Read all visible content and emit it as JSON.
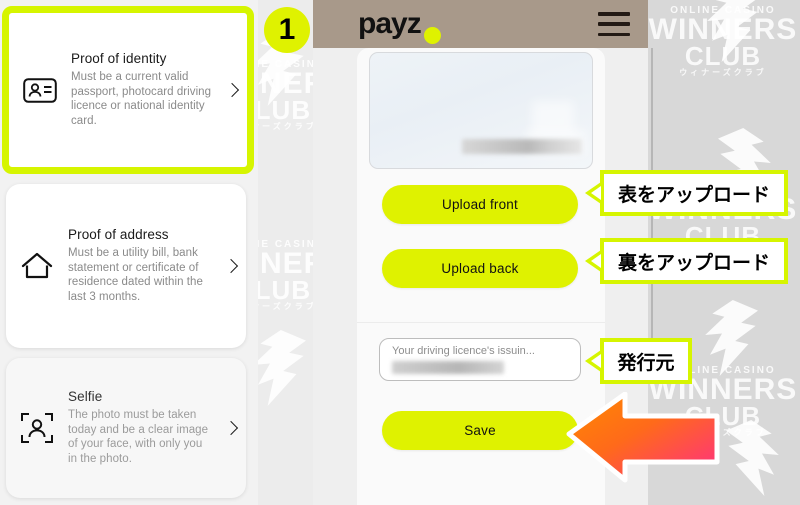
{
  "badge": {
    "number": "1"
  },
  "sidebar": {
    "cards": [
      {
        "id": "proof-of-identity",
        "title": "Proof of identity",
        "description": "Must be a current valid passport, photocard driving licence or national identity card.",
        "icon": "id-card-icon",
        "selected": true
      },
      {
        "id": "proof-of-address",
        "title": "Proof of address",
        "description": "Must be a utility bill, bank statement or certificate of residence dated within the last 3 months.",
        "icon": "home-icon",
        "selected": false
      },
      {
        "id": "selfie",
        "title": "Selfie",
        "description": "The photo must be taken today and be a clear image of your face, with only you in the photo.",
        "icon": "selfie-person-icon",
        "selected": false
      }
    ],
    "chevron_icon": "chevron-right-icon"
  },
  "phone": {
    "header": {
      "logo_text": "payz",
      "logo_dot": "payz-dot-icon",
      "menu_icon": "hamburger-menu-icon",
      "background_color": "#a8998a"
    },
    "preview": {
      "label": "document-preview-image",
      "blurred": true
    },
    "buttons": {
      "upload_front": "Upload front",
      "upload_back": "Upload back",
      "save": "Save"
    },
    "field": {
      "label": "Your driving licence's issuin...",
      "value_blurred": true
    }
  },
  "callouts": [
    {
      "id": "upload-front",
      "text": "表をアップロード"
    },
    {
      "id": "upload-back",
      "text": "裏をアップロード"
    },
    {
      "id": "issuer",
      "text": "発行元"
    }
  ],
  "arrow": {
    "name": "pointer-arrow-left",
    "gradient_from": "#ff8a00",
    "gradient_to": "#ff2d86"
  },
  "watermark": {
    "line1": "ONLINE CASINO",
    "line2": "WINNERS",
    "line3": "CLUB",
    "line4": "ウィナーズクラブ"
  },
  "colors": {
    "accent_yellow": "#dff200",
    "callout_border": "#d6f500",
    "header_taupe": "#a8998a"
  }
}
